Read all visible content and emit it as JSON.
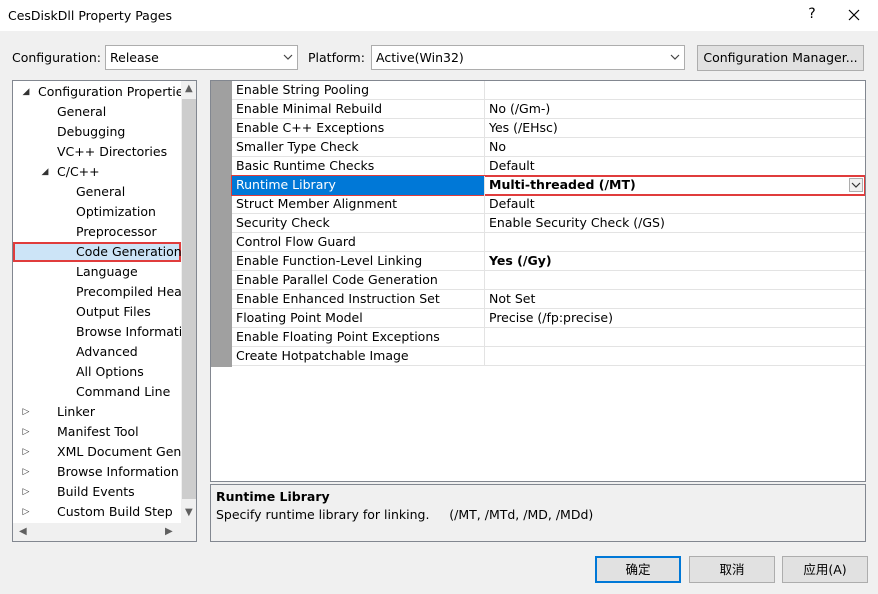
{
  "window": {
    "title": "CesDiskDll Property Pages",
    "help_glyph": "?"
  },
  "config": {
    "configuration_label": "Configuration:",
    "configuration_value": "Release",
    "platform_label": "Platform:",
    "platform_value": "Active(Win32)",
    "manager_button": "Configuration Manager..."
  },
  "tree": {
    "items": [
      {
        "label": "Configuration Properties",
        "expander": "◢"
      },
      {
        "label": "General"
      },
      {
        "label": "Debugging"
      },
      {
        "label": "VC++ Directories"
      },
      {
        "label": "C/C++",
        "expander": "◢"
      },
      {
        "label": "General"
      },
      {
        "label": "Optimization"
      },
      {
        "label": "Preprocessor"
      },
      {
        "label": "Code Generation",
        "selected": true
      },
      {
        "label": "Language"
      },
      {
        "label": "Precompiled Head"
      },
      {
        "label": "Output Files"
      },
      {
        "label": "Browse Informatic"
      },
      {
        "label": "Advanced"
      },
      {
        "label": "All Options"
      },
      {
        "label": "Command Line"
      },
      {
        "label": "Linker",
        "expander": "▷"
      },
      {
        "label": "Manifest Tool",
        "expander": "▷"
      },
      {
        "label": "XML Document Gene",
        "expander": "▷"
      },
      {
        "label": "Browse Information",
        "expander": "▷"
      },
      {
        "label": "Build Events",
        "expander": "▷"
      },
      {
        "label": "Custom Build Step",
        "expander": "▷"
      }
    ]
  },
  "grid": {
    "rows": [
      {
        "name": "Enable String Pooling",
        "value": ""
      },
      {
        "name": "Enable Minimal Rebuild",
        "value": "No (/Gm-)"
      },
      {
        "name": "Enable C++ Exceptions",
        "value": "Yes (/EHsc)"
      },
      {
        "name": "Smaller Type Check",
        "value": "No"
      },
      {
        "name": "Basic Runtime Checks",
        "value": "Default"
      },
      {
        "name": "Runtime Library",
        "value": "Multi-threaded (/MT)",
        "selected": true
      },
      {
        "name": "Struct Member Alignment",
        "value": "Default"
      },
      {
        "name": "Security Check",
        "value": "Enable Security Check (/GS)"
      },
      {
        "name": "Control Flow Guard",
        "value": ""
      },
      {
        "name": "Enable Function-Level Linking",
        "value": "Yes (/Gy)",
        "bold": true
      },
      {
        "name": "Enable Parallel Code Generation",
        "value": ""
      },
      {
        "name": "Enable Enhanced Instruction Set",
        "value": "Not Set"
      },
      {
        "name": "Floating Point Model",
        "value": "Precise (/fp:precise)"
      },
      {
        "name": "Enable Floating Point Exceptions",
        "value": ""
      },
      {
        "name": "Create Hotpatchable Image",
        "value": ""
      }
    ]
  },
  "description": {
    "title": "Runtime Library",
    "text": "Specify runtime library for linking.     (/MT, /MTd, /MD, /MDd)"
  },
  "buttons": {
    "ok": "确定",
    "cancel": "取消",
    "apply": "应用(A)"
  },
  "colors": {
    "accent": "#0078d7",
    "highlight": "#e03c3c",
    "gutter": "#a0a0a0"
  }
}
